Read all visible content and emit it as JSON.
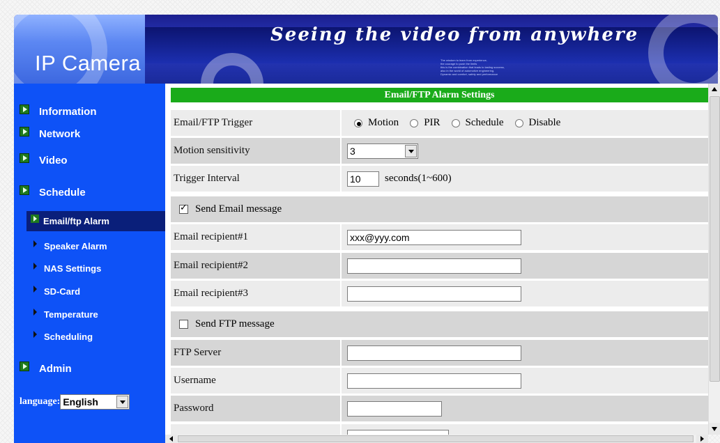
{
  "banner": {
    "logo": "IP Camera",
    "tagline": "Seeing the video from anywhere",
    "fine_print": [
      "The wisdom to learn from experience,",
      "the courage to push the limits",
      "this is the combination that leads to lasting success,",
      "also in the world of automotive engineering.",
      "Dynamic and comfort, safety and performance"
    ]
  },
  "sidebar": {
    "main": [
      {
        "label": "Information"
      },
      {
        "label": "Network"
      },
      {
        "label": "Video"
      },
      {
        "label": "Schedule"
      },
      {
        "label": "Admin"
      }
    ],
    "sub": [
      {
        "label": "Email/ftp Alarm",
        "active": true
      },
      {
        "label": "Speaker Alarm"
      },
      {
        "label": "NAS Settings"
      },
      {
        "label": "SD-Card"
      },
      {
        "label": "Temperature"
      },
      {
        "label": "Scheduling"
      }
    ],
    "language": {
      "label": "language:",
      "value": "English"
    }
  },
  "content": {
    "title": "Email/FTP Alarm Settings",
    "trigger": {
      "label": "Email/FTP Trigger",
      "options": [
        "Motion",
        "PIR",
        "Schedule",
        "Disable"
      ],
      "selected": "Motion"
    },
    "motion_sensitivity": {
      "label": "Motion sensitivity",
      "value": "3"
    },
    "trigger_interval": {
      "label": "Trigger Interval",
      "value": "10",
      "unit": "seconds(1~600)"
    },
    "send_email": {
      "label": "Send Email message",
      "checked": true
    },
    "email1": {
      "label": "Email recipient#1",
      "value": "xxx@yyy.com"
    },
    "email2": {
      "label": "Email recipient#2",
      "value": ""
    },
    "email3": {
      "label": "Email recipient#3",
      "value": ""
    },
    "send_ftp": {
      "label": "Send FTP message",
      "checked": false
    },
    "ftp_server": {
      "label": "FTP Server",
      "value": ""
    },
    "username": {
      "label": "Username",
      "value": ""
    },
    "password": {
      "label": "Password",
      "value": ""
    }
  }
}
